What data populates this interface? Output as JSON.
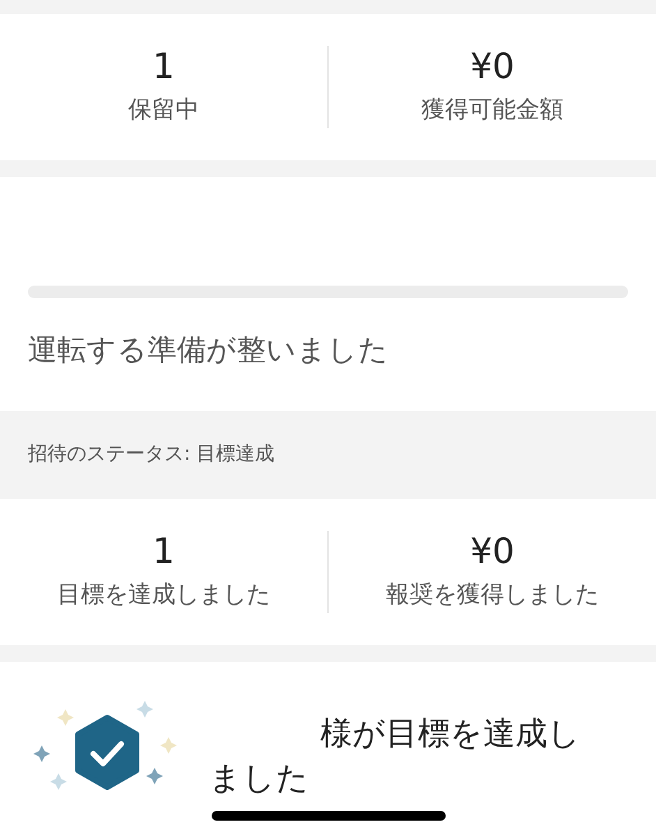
{
  "summary_stats": [
    {
      "value": "1",
      "label": "保留中"
    },
    {
      "value": "¥0",
      "label": "獲得可能金額"
    }
  ],
  "progress": {
    "message": "運転する準備が整いました"
  },
  "invite_status": {
    "label": "招待のステータス: 目標達成"
  },
  "goal_stats": [
    {
      "value": "1",
      "label": "目標を達成しました"
    },
    {
      "value": "¥0",
      "label": "報奨を獲得しました"
    }
  ],
  "achievement": {
    "message": "様が目標を達成しました"
  }
}
